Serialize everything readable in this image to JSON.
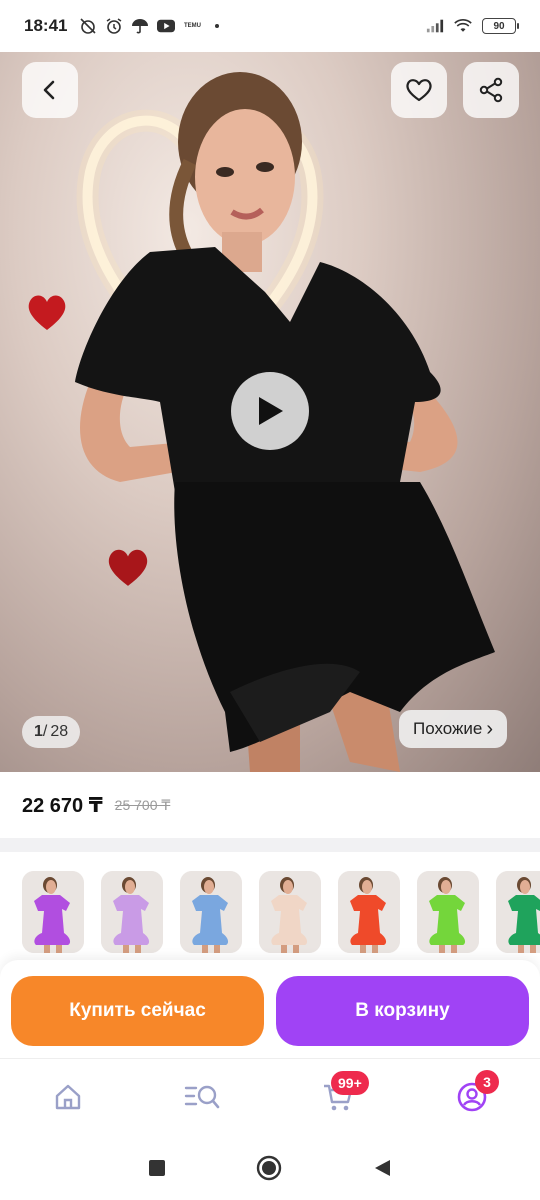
{
  "status_bar": {
    "time": "18:41",
    "temu_label": "TEMU",
    "battery": "90",
    "icons": [
      "alarm-off-icon",
      "alarm-icon",
      "umbrella-icon",
      "youtube-icon",
      "temu-icon",
      "signal-icon",
      "wifi-icon",
      "battery-icon"
    ]
  },
  "gallery": {
    "current": "1",
    "separator": "/",
    "total": "28",
    "similar_label": "Похожие",
    "similar_chevron": "›"
  },
  "price": {
    "current": "22 670 ₸",
    "old": "25 700 ₸"
  },
  "variants": [
    {
      "name": "purple",
      "color": "#b14ee0"
    },
    {
      "name": "lilac",
      "color": "#c99be6"
    },
    {
      "name": "blue",
      "color": "#7aa7df"
    },
    {
      "name": "beige",
      "color": "#f0d6c6"
    },
    {
      "name": "red",
      "color": "#ef4a2a"
    },
    {
      "name": "lime",
      "color": "#74d63b"
    },
    {
      "name": "green",
      "color": "#1fa35c"
    }
  ],
  "actions": {
    "buy_now": "Купить сейчас",
    "add_to_cart": "В корзину"
  },
  "bottom_nav": {
    "cart_badge": "99+",
    "profile_badge": "3"
  },
  "colors": {
    "buy_button": "#f78729",
    "cart_button": "#a043f5",
    "badge": "#ee2a4d",
    "nav_icon": "#9aa0c8",
    "profile_icon": "#a043f5"
  }
}
